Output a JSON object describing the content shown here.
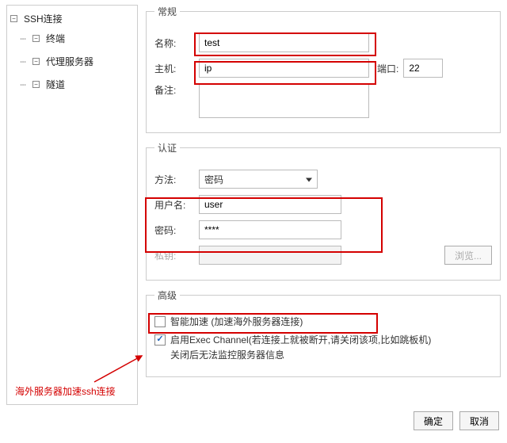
{
  "tree": {
    "root": "SSH连接",
    "children": [
      "终端",
      "代理服务器",
      "隧道"
    ]
  },
  "general": {
    "legend": "常规",
    "name_label": "名称:",
    "name_value": "test",
    "host_label": "主机:",
    "host_value": "ip",
    "port_label": "端口:",
    "port_value": "22",
    "remark_label": "备注:",
    "remark_value": ""
  },
  "auth": {
    "legend": "认证",
    "method_label": "方法:",
    "method_value": "密码",
    "user_label": "用户名:",
    "user_value": "user",
    "pass_label": "密码:",
    "pass_value": "****",
    "privkey_label": "私钥:",
    "browse_label": "浏览..."
  },
  "advanced": {
    "legend": "高级",
    "smart_accel_label": "智能加速 (加速海外服务器连接)",
    "exec_channel_label": "启用Exec Channel(若连接上就被断开,请关闭该项,比如跳板机)",
    "exec_channel_sub": "关闭后无法监控服务器信息"
  },
  "annotation": "海外服务器加速ssh连接",
  "buttons": {
    "ok": "确定",
    "cancel": "取消"
  }
}
